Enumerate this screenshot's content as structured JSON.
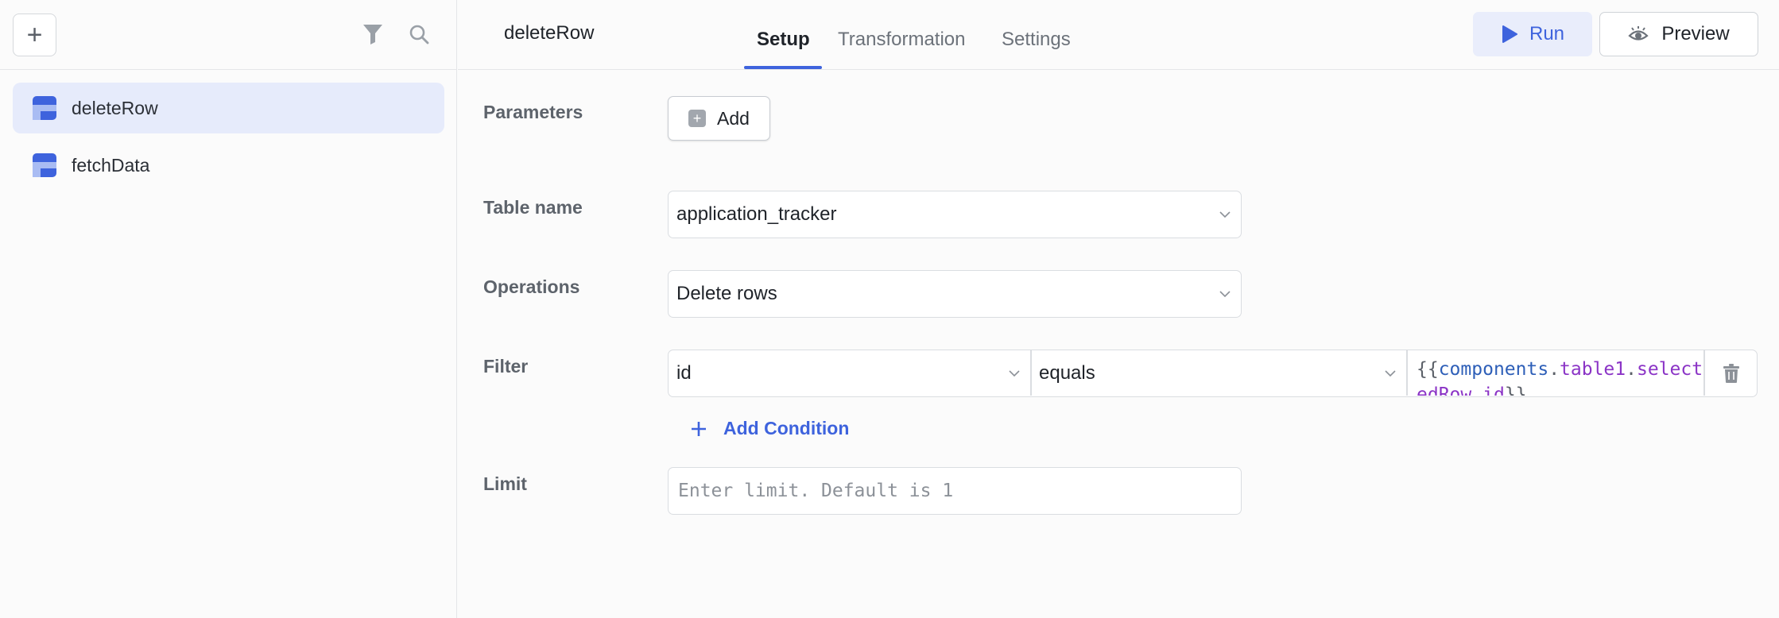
{
  "sidebar": {
    "add_label": "+",
    "items": [
      {
        "label": "deleteRow",
        "icon": "database-icon",
        "active": true
      },
      {
        "label": "fetchData",
        "icon": "database-icon",
        "active": false
      }
    ]
  },
  "header": {
    "query_name": "deleteRow",
    "tabs": [
      {
        "label": "Setup",
        "active": true
      },
      {
        "label": "Transformation",
        "active": false
      },
      {
        "label": "Settings",
        "active": false
      }
    ],
    "run_label": "Run",
    "preview_label": "Preview"
  },
  "form": {
    "parameters": {
      "label": "Parameters",
      "add_label": "Add"
    },
    "table_name": {
      "label": "Table name",
      "value": "application_tracker"
    },
    "operations": {
      "label": "Operations",
      "value": "Delete rows"
    },
    "filter": {
      "label": "Filter",
      "column": "id",
      "operator": "equals",
      "value_open": "{{",
      "value_part1": "components",
      "value_dot1": ".",
      "value_part2": "table1",
      "value_dot2": ".",
      "value_part3": "selectedRow",
      "value_dot3": ".",
      "value_part4": "id",
      "value_close": "}}",
      "add_condition_label": "Add Condition"
    },
    "limit": {
      "label": "Limit",
      "placeholder": "Enter limit. Default is 1",
      "value": ""
    }
  },
  "colors": {
    "accent": "#3e63dd",
    "active_bg": "#e6ebfb",
    "code_blue": "#2e5fb8",
    "code_purple": "#8b34c6"
  }
}
